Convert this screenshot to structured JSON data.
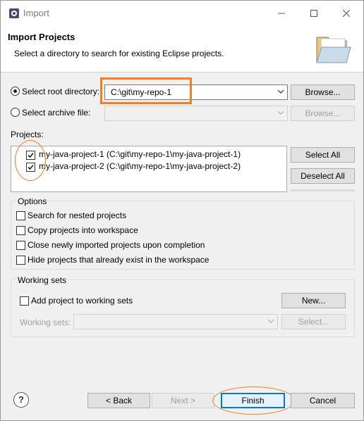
{
  "window": {
    "title": "Import",
    "minimize_icon": "minimize-icon",
    "maximize_icon": "maximize-icon",
    "close_icon": "close-icon"
  },
  "header": {
    "title": "Import Projects",
    "description": "Select a directory to search for existing Eclipse projects.",
    "banner_icon": "folder-icon"
  },
  "source": {
    "root_directory_label": "Select root directory:",
    "root_directory_selected": true,
    "root_directory_value": "C:\\git\\my-repo-1",
    "archive_file_label": "Select archive file:",
    "archive_file_value": "",
    "browse_label": "Browse...",
    "browse_archive_label": "Browse..."
  },
  "projects": {
    "label": "Projects:",
    "items": [
      {
        "label": "my-java-project-1 (C:\\git\\my-repo-1\\my-java-project-1)",
        "checked": true
      },
      {
        "label": "my-java-project-2 (C:\\git\\my-repo-1\\my-java-project-2)",
        "checked": true
      }
    ],
    "select_all_label": "Select All",
    "deselect_all_label": "Deselect All"
  },
  "options": {
    "title": "Options",
    "items": [
      {
        "label": "Search for nested projects",
        "checked": false
      },
      {
        "label": "Copy projects into workspace",
        "checked": false
      },
      {
        "label": "Close newly imported projects upon completion",
        "checked": false
      },
      {
        "label": "Hide projects that already exist in the workspace",
        "checked": false
      }
    ]
  },
  "working_sets": {
    "title": "Working sets",
    "add_label": "Add project to working sets",
    "add_checked": false,
    "new_label": "New...",
    "sets_label": "Working sets:",
    "sets_value": "",
    "select_label": "Select..."
  },
  "footer": {
    "help_icon": "help-icon",
    "help_glyph": "?",
    "back_label": "< Back",
    "next_label": "Next >",
    "finish_label": "Finish",
    "cancel_label": "Cancel"
  },
  "colors": {
    "annotation": "#f07f2a",
    "dialog_bg": "#f0f0f0",
    "focus_border": "#0078d7"
  }
}
